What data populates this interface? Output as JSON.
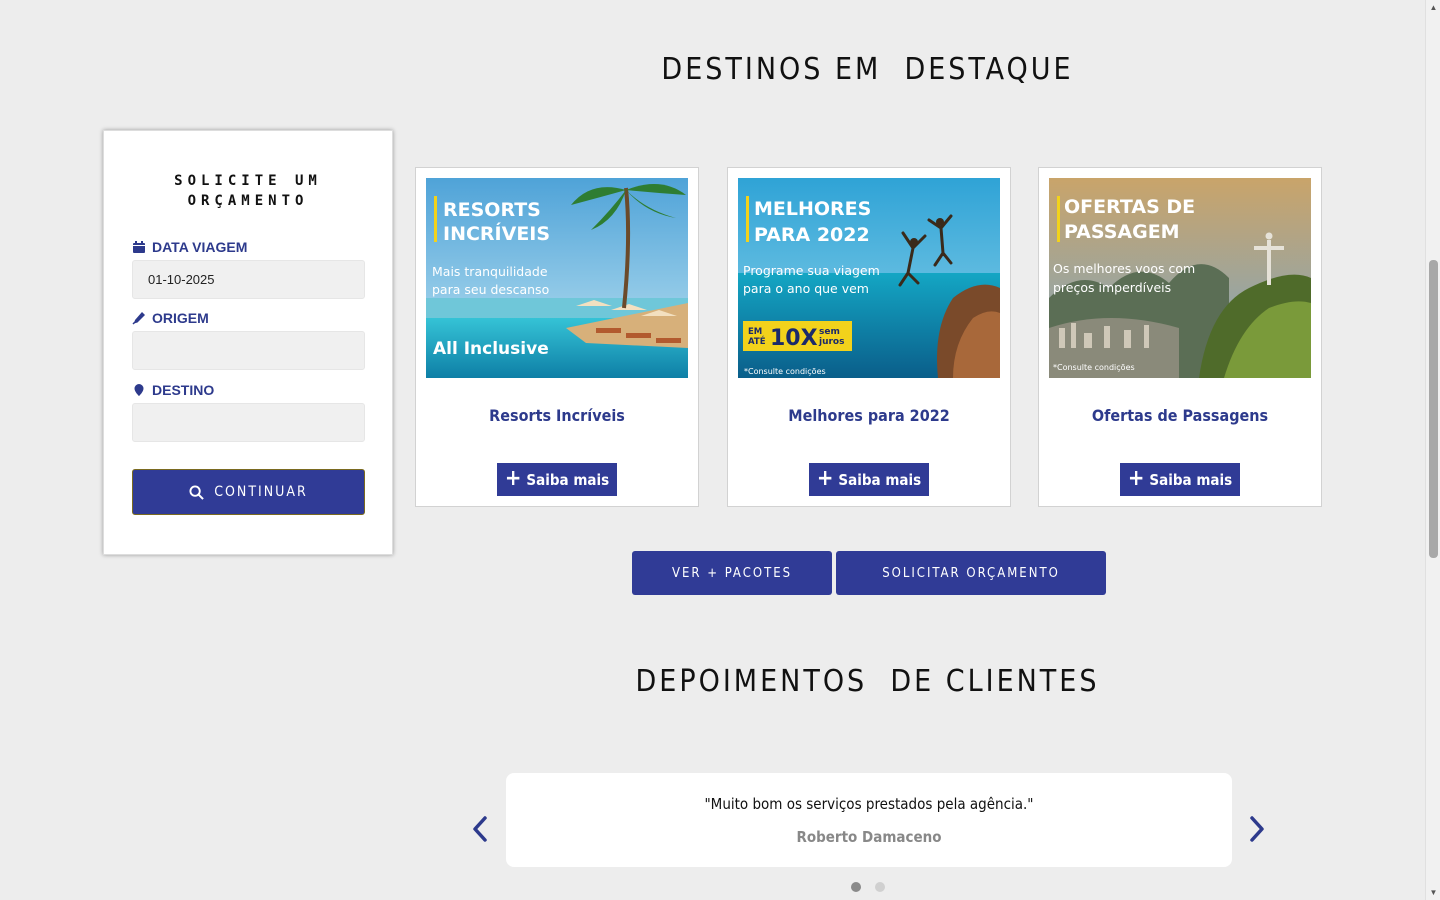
{
  "sections": {
    "destinos_title": "DESTINOS EM  DESTAQUE",
    "depoimentos_title": "DEPOIMENTOS  DE CLIENTES"
  },
  "quote_form": {
    "title_line1": "SOLICITE UM",
    "title_line2": "ORÇAMENTO",
    "date_label": "DATA VIAGEM",
    "date_value": "01-10-2025",
    "origin_label": "ORIGEM",
    "origin_value": "",
    "destination_label": "DESTINO",
    "destination_value": "",
    "continue_label": "CONTINUAR"
  },
  "cards": [
    {
      "title": "Resorts Incríveis",
      "button": "Saiba mais",
      "image_heading1": "RESORTS",
      "image_heading2": "INCRÍVEIS",
      "image_sub1": "Mais tranquilidade",
      "image_sub2": "para seu descanso",
      "image_badge": "All Inclusive"
    },
    {
      "title": "Melhores para 2022",
      "button": "Saiba mais",
      "image_heading1": "MELHORES",
      "image_heading2": "PARA 2022",
      "image_sub1": "Programe sua viagem",
      "image_sub2": "para o ano que vem",
      "image_badge_small1": "EM",
      "image_badge_small2": "ATÉ",
      "image_badge": "10X",
      "image_badge_tail1": "sem",
      "image_badge_tail2": "juros",
      "image_note": "*Consulte condições"
    },
    {
      "title": "Ofertas de Passagens",
      "button": "Saiba mais",
      "image_heading1": "OFERTAS DE",
      "image_heading2": "PASSAGEM",
      "image_sub1": "Os melhores voos com",
      "image_sub2": "preços imperdíveis",
      "image_note": "*Consulte condições"
    }
  ],
  "actions": {
    "pacotes": "VER + PACOTES",
    "orcamento": "SOLICITAR ORÇAMENTO"
  },
  "testimonial": {
    "text": "\"Muito bom os serviços prestados pela agência.\"",
    "author": "Roberto Damaceno",
    "slides_total": 2,
    "slide_active": 1
  },
  "colors": {
    "primary": "#303b96",
    "label": "#2d3a8c",
    "background": "#ededed",
    "accent_yellow": "#f2d21b"
  }
}
